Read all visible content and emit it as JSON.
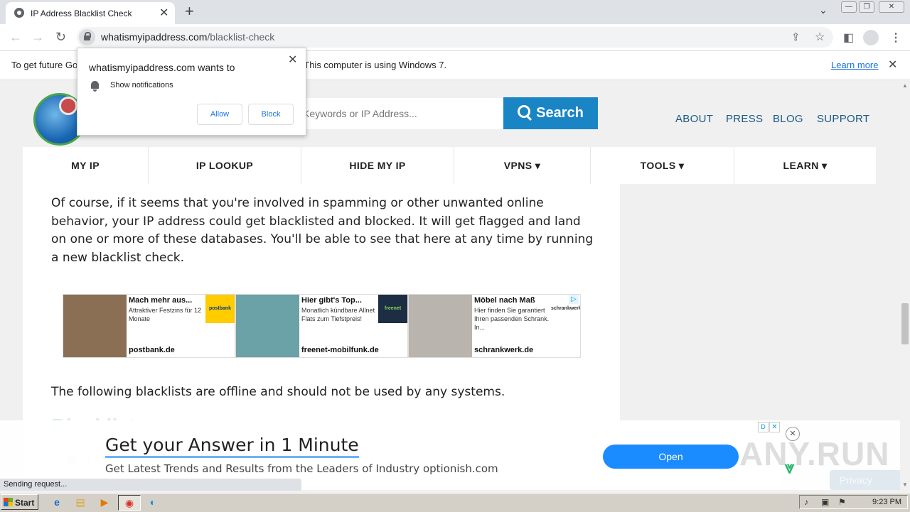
{
  "browser": {
    "tab_title": "IP Address Blacklist Check",
    "tab_close": "✕",
    "new_tab": "+",
    "tab_search": "⌄",
    "url_host": "whatismyipaddress.com",
    "url_path": "/blacklist-check",
    "win_min": "—",
    "win_max": "❐",
    "win_close": "✕"
  },
  "infobar": {
    "message": "To get future Google Chrome updates, you'll need Windows 10 or later. This computer is using Windows 7.",
    "link": "Learn more",
    "close": "✕"
  },
  "notification": {
    "title": "whatismyipaddress.com wants to",
    "permission": "Show notifications",
    "allow": "Allow",
    "block": "Block",
    "close": "✕"
  },
  "site": {
    "search_placeholder": "Keywords or IP Address...",
    "search_button": "Search",
    "top_links": [
      "ABOUT",
      "PRESS",
      "BLOG",
      "SUPPORT"
    ],
    "nav": [
      {
        "label": "MY IP"
      },
      {
        "label": "IP LOOKUP"
      },
      {
        "label": "HIDE MY IP"
      },
      {
        "label": "VPNS ▾"
      },
      {
        "label": "TOOLS ▾"
      },
      {
        "label": "LEARN ▾"
      }
    ],
    "para1": "Of course, if it seems that you're involved in spamming or other unwanted online behavior, your IP address could get blacklisted and blocked. It will get flagged and land on one or more of these databases. You'll be able to see that here at any time by running a new blacklist check.",
    "para2": "The following blacklists are offline and should not be used by any systems.",
    "heading_partial": "Blacklist",
    "ghost_item": "bl"
  },
  "ads": [
    {
      "title": "Mach mehr aus...",
      "desc": "Attraktiver Festzins für 12 Monate",
      "domain": "postbank.de",
      "logo": "postbank",
      "logo_bg": "#ffcc00",
      "logo_color": "#0a3a7a",
      "img_bg": "#8a6f55"
    },
    {
      "title": "Hier gibt's Top...",
      "desc": "Monatlich kündbare Allnet Flats zum Tiefstpreis!",
      "domain": "freenet-mobilfunk.de",
      "logo": "freenet",
      "logo_bg": "#1d2d44",
      "logo_color": "#7ed957",
      "img_bg": "#6aa2a8"
    },
    {
      "title": "Möbel nach Maß",
      "desc": "Hier finden Sie garantiert Ihren passenden Schrank. In...",
      "domain": "schrankwerk.de",
      "logo": "schrankwerk",
      "logo_bg": "#ffffff",
      "logo_color": "#333333",
      "img_bg": "#b9b4ad"
    }
  ],
  "adchoices": "▷",
  "bottom_ad": {
    "headline": "Get your Answer in 1 Minute",
    "sub": "Get Latest Trends and Results from the Leaders of Industry optionish.com",
    "button": "Open",
    "dp": "D",
    "x": "✕",
    "close": "✕",
    "brand_icon": "⩔"
  },
  "watermark": "ANY.RUN",
  "privacy": "Privacy",
  "status": "Sending request...",
  "taskbar": {
    "start": "Start",
    "clock": "9:23 PM",
    "apps": [
      "e",
      "▤",
      "▶",
      "◉",
      "◐"
    ],
    "tray_icons": [
      "♪",
      "▣",
      "⚑"
    ]
  },
  "colors": {
    "accent": "#1a85c5",
    "nav_link": "#1b5a86",
    "ad_button": "#1a8cff"
  }
}
